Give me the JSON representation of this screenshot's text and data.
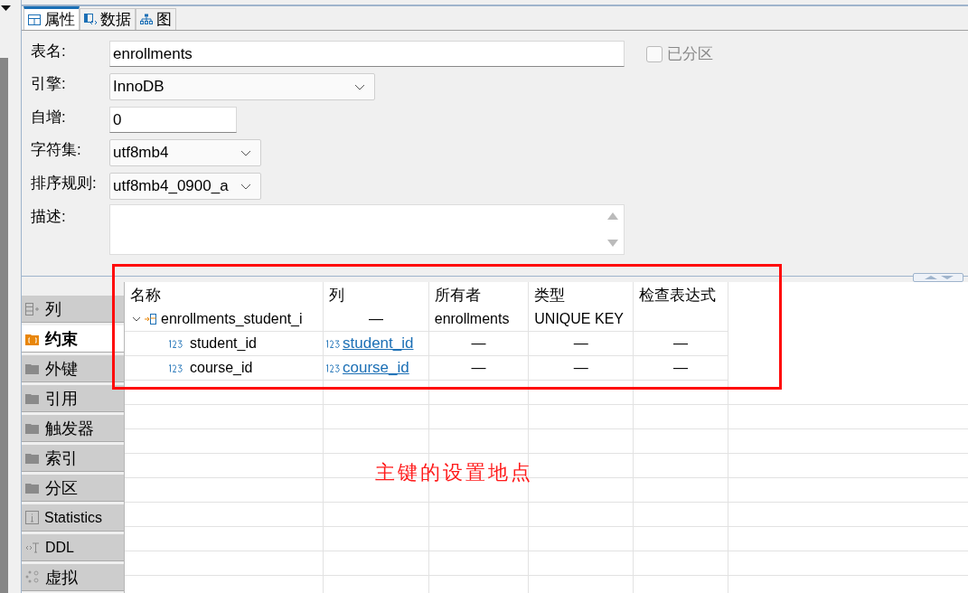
{
  "tabs": [
    {
      "label": "属性",
      "kind": "grid",
      "selected": true
    },
    {
      "label": "数据",
      "kind": "data",
      "selected": false
    },
    {
      "label": "图",
      "kind": "diagram",
      "selected": false
    }
  ],
  "form": {
    "table_name": {
      "label": "表名:",
      "value": "enrollments"
    },
    "partitioned": {
      "label": "已分区",
      "checked": false,
      "disabled": true
    },
    "engine": {
      "label": "引擎:",
      "value": "InnoDB"
    },
    "auto_increment": {
      "label": "自增:",
      "value": "0"
    },
    "charset": {
      "label": "字符集:",
      "value": "utf8mb4"
    },
    "collation": {
      "label": "排序规则:",
      "value": "utf8mb4_0900_a"
    },
    "description": {
      "label": "描述:"
    }
  },
  "side_tabs": [
    {
      "label": "列",
      "kind": "columns",
      "selected": false
    },
    {
      "label": "约束",
      "kind": "constraint",
      "selected": true
    },
    {
      "label": "外键",
      "kind": "folder",
      "selected": false
    },
    {
      "label": "引用",
      "kind": "folder",
      "selected": false
    },
    {
      "label": "触发器",
      "kind": "folder",
      "selected": false
    },
    {
      "label": "索引",
      "kind": "folder",
      "selected": false
    },
    {
      "label": "分区",
      "kind": "folder",
      "selected": false
    },
    {
      "label": "Statistics",
      "kind": "info",
      "selected": false
    },
    {
      "label": "DDL",
      "kind": "ddl",
      "selected": false
    },
    {
      "label": "虚拟",
      "kind": "virtual",
      "selected": false
    }
  ],
  "table": {
    "columns": [
      "名称",
      "列",
      "所有者",
      "类型",
      "检查表达式"
    ],
    "rows": [
      {
        "name": "enrollments_student_i",
        "column": "—",
        "owner": "enrollments",
        "type": "UNIQUE KEY",
        "expanded": true,
        "children": [
          {
            "name": "student_id",
            "column": "student_id",
            "owner": "—",
            "type": "—",
            "check": "—"
          },
          {
            "name": "course_id",
            "column": "course_id",
            "owner": "—",
            "type": "—",
            "check": "—"
          }
        ]
      }
    ]
  },
  "annotation": {
    "text": "主键的设置地点"
  }
}
